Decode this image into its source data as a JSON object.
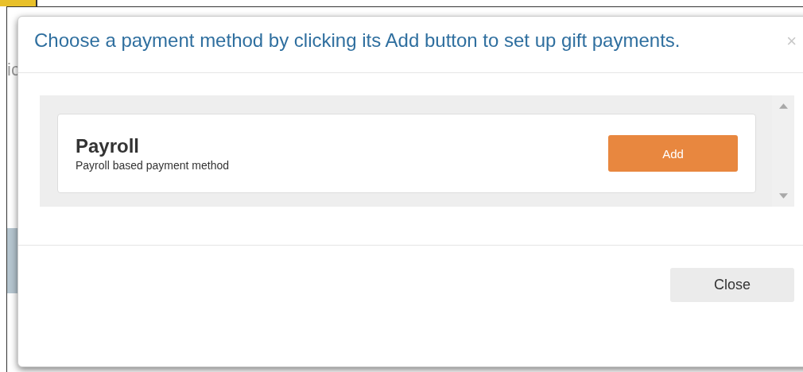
{
  "background": {
    "partial_text": "ic"
  },
  "modal": {
    "title": "Choose a payment method by clicking its Add button to set up gift payments.",
    "close_icon": "×",
    "methods": [
      {
        "name": "Payroll",
        "description": "Payroll based payment method",
        "button": "Add"
      }
    ],
    "footer_button": "Close"
  }
}
